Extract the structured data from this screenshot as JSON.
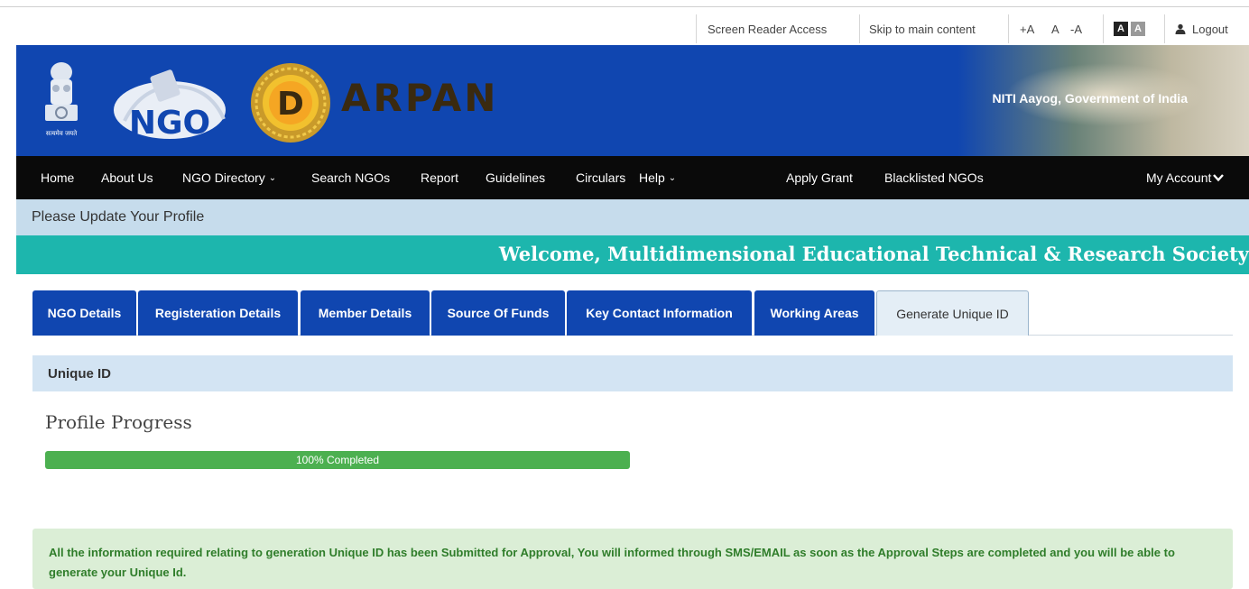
{
  "utility": {
    "screen_reader": "Screen Reader Access",
    "skip": "Skip to main content",
    "font_plus": "+A",
    "font_normal": "A",
    "font_minus": "-A",
    "contrast_dark": "A",
    "contrast_light": "A",
    "logout": "Logout"
  },
  "header": {
    "ngo_logo_text": "NGO",
    "darpan_initial": "D",
    "darpan_rest": "ARPAN",
    "emblem_caption": "सत्यमेव जयते",
    "right_text": "NITI Aayog, Government of India"
  },
  "nav": {
    "home": "Home",
    "about": "About Us",
    "directory": "NGO Directory",
    "search": "Search NGOs",
    "report": "Report",
    "guidelines": "Guidelines",
    "circulars": "Circulars",
    "help": "Help",
    "apply_grant": "Apply Grant",
    "blacklisted": "Blacklisted NGOs",
    "my_account": "My Account"
  },
  "notice": "Please Update Your Profile",
  "welcome": "Welcome, Multidimensional Educational Technical & Research Society",
  "tabs": [
    {
      "label": "NGO Details"
    },
    {
      "label": "Registeration Details"
    },
    {
      "label": "Member Details"
    },
    {
      "label": "Source Of Funds"
    },
    {
      "label": "Key Contact Information"
    },
    {
      "label": "Working Areas"
    },
    {
      "label": "Generate Unique ID"
    }
  ],
  "active_tab": "Generate Unique ID",
  "section_title": "Unique ID",
  "progress": {
    "title": "Profile Progress",
    "percent": 100,
    "label": "100% Completed"
  },
  "alert": "All the information required relating to generation Unique ID has been Submitted for Approval, You will informed through SMS/EMAIL as soon as the Approval Steps are completed and you will be able to generate your Unique Id.",
  "colors": {
    "banner_blue": "#1046b0",
    "welcome_teal": "#1db6ad",
    "progress_green": "#4cb050",
    "alert_bg": "#dbeed6"
  }
}
